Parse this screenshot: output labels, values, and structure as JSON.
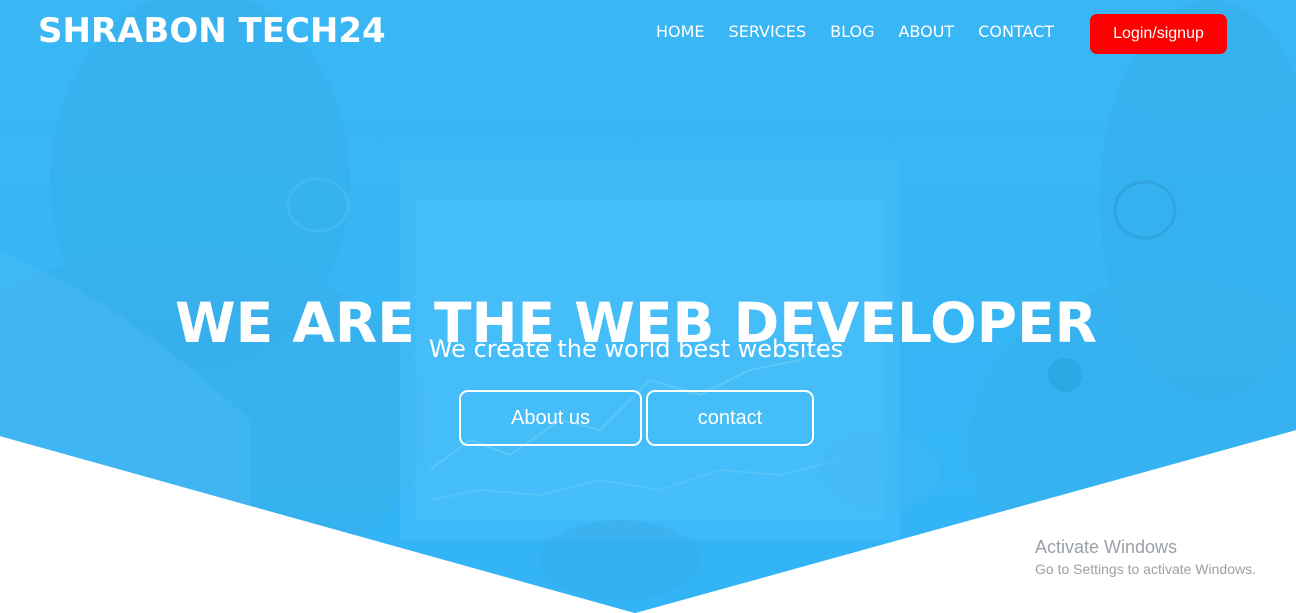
{
  "brand": {
    "name": "SHRABON TECH24"
  },
  "nav": {
    "items": [
      {
        "label": "HOME"
      },
      {
        "label": "SERVICES"
      },
      {
        "label": "BLOG"
      },
      {
        "label": "ABOUT"
      },
      {
        "label": "CONTACT"
      }
    ],
    "login_label": "Login/signup"
  },
  "hero": {
    "headline": "WE ARE THE WEB DEVELOPER",
    "subline": "We create the world best websites",
    "buttons": {
      "about_label": "About us",
      "contact_label": "contact"
    }
  },
  "watermark": {
    "title": "Activate Windows",
    "subtitle": "Go to Settings to activate Windows."
  },
  "colors": {
    "hero_overlay": "#3ab8f6",
    "login_button": "#ff0000",
    "text": "#ffffff"
  }
}
